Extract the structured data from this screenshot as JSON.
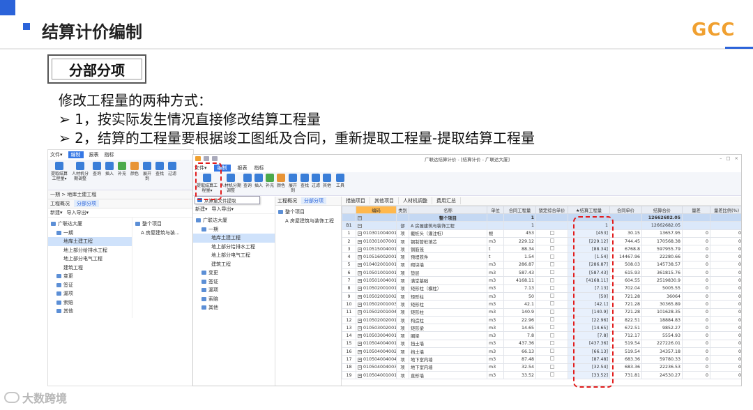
{
  "slide": {
    "title": "结算计价编制",
    "logo": "GCC",
    "section": "分部分项",
    "lines": [
      "修改工程量的两种方式：",
      "➢ 1，按实际发生情况直接修改结算工程量",
      "➢ 2，结算的工程量要根据竣工图纸及合同，重新提取工程量-提取结算工程量"
    ],
    "watermark": "大数跨境"
  },
  "left_app": {
    "menu": [
      "文件▾",
      "编制",
      "报表",
      "指标"
    ],
    "ribbon": [
      "提取结算工程量▾",
      "人材机分期调整",
      "查询",
      "插入",
      "补充",
      "颜色",
      "展开到",
      "查找",
      "过滤"
    ],
    "nav": [
      "一期 > 地库土建工程"
    ],
    "panel_tabs": [
      "工程概况",
      "分部分项"
    ],
    "tree_toolbar": [
      "新建▾",
      "导入导出▾"
    ],
    "tree": [
      {
        "label": "广联达大厦",
        "level": 0
      },
      {
        "label": "一期",
        "level": 1
      },
      {
        "label": "地库土建工程",
        "level": 2,
        "selected": true
      },
      {
        "label": "地上部分给排水工程",
        "level": 2
      },
      {
        "label": "地上部分电气工程",
        "level": 2
      },
      {
        "label": "建筑工程",
        "level": 2
      },
      {
        "label": "变更",
        "level": 1
      },
      {
        "label": "签证",
        "level": 1
      },
      {
        "label": "漏项",
        "level": 1
      },
      {
        "label": "索赔",
        "level": 1
      },
      {
        "label": "其他",
        "level": 1
      }
    ],
    "subtree": [
      "整个项目",
      "A 房屋建筑与装..."
    ]
  },
  "right_app": {
    "window_title": "广联达结算计价 - [结算计价 - 广联达大厦]",
    "menu": [
      "文件▾",
      "编制",
      "报表",
      "指标"
    ],
    "ribbon": [
      "提取结算工程量▾",
      "人材机分期调整",
      "查询",
      "插入",
      "补充",
      "颜色",
      "展开到",
      "查找",
      "过滤",
      "其他",
      "工具"
    ],
    "dropdown_item": "从算量文件提取",
    "tree_toolbar": [
      "新建▾",
      "导入导出▾"
    ],
    "panel_tabs": [
      "工程概况",
      "分部分项"
    ],
    "grid_tabs": [
      "措施项目",
      "其他项目",
      "人材机调整",
      "费用汇总"
    ],
    "subtree": [
      "整个项目",
      "A 房屋建筑与装饰工程"
    ],
    "columns": [
      "",
      "编码",
      "类别",
      "名称",
      "单位",
      "合同工程量",
      "锁定综合单价",
      "★结算工程量",
      "合同单价",
      "结算合价",
      "量差",
      "量差比例(%)"
    ],
    "root_row": {
      "name": "整个项目",
      "qty": "1",
      "settle": "",
      "total": "12662682.05"
    },
    "part_row": {
      "idx": "B1",
      "type": "部",
      "name": "A 房屋建筑与装饰工程",
      "qty": "1",
      "settle": "1",
      "total": "12662682.05"
    },
    "rows": [
      {
        "idx": "1",
        "code": "010301004001",
        "type": "项",
        "name": "截桩头（灌注桩）",
        "unit": "根",
        "qty": "453",
        "settle": "[453]",
        "price": "30.15",
        "total": "13657.95",
        "diff": "0",
        "ratio": "0"
      },
      {
        "idx": "2",
        "code": "010301007001",
        "type": "项",
        "name": "钢制管桩填芯",
        "unit": "m3",
        "qty": "229.12",
        "settle": "[229.12]",
        "price": "744.45",
        "total": "170568.38",
        "diff": "0",
        "ratio": "0"
      },
      {
        "idx": "3",
        "code": "010515004001",
        "type": "项",
        "name": "钢筋笼",
        "unit": "t",
        "qty": "88.34",
        "settle": "[88.34]",
        "price": "6768.8",
        "total": "597955.79",
        "diff": "0",
        "ratio": "0"
      },
      {
        "idx": "4",
        "code": "010516002001",
        "type": "项",
        "name": "预埋铁件",
        "unit": "t",
        "qty": "1.54",
        "settle": "[1.54]",
        "price": "14467.96",
        "total": "22280.66",
        "diff": "0",
        "ratio": "0"
      },
      {
        "idx": "5",
        "code": "010402001001",
        "type": "项",
        "name": "砌块墙",
        "unit": "m3",
        "qty": "286.87",
        "settle": "[286.87]",
        "price": "508.03",
        "total": "145738.57",
        "diff": "0",
        "ratio": "0"
      },
      {
        "idx": "6",
        "code": "010501001001",
        "type": "项",
        "name": "垫层",
        "unit": "m3",
        "qty": "587.43",
        "settle": "[587.43]",
        "price": "615.93",
        "total": "361815.76",
        "diff": "0",
        "ratio": "0"
      },
      {
        "idx": "7",
        "code": "010501004001",
        "type": "项",
        "name": "满堂基础",
        "unit": "m3",
        "qty": "4168.11",
        "settle": "[4168.11]",
        "price": "604.55",
        "total": "2519830.9",
        "diff": "0",
        "ratio": "0"
      },
      {
        "idx": "8",
        "code": "010502001001",
        "type": "项",
        "name": "矩形柱（模柱）",
        "unit": "m3",
        "qty": "7.13",
        "settle": "[7.13]",
        "price": "702.04",
        "total": "5005.55",
        "diff": "0",
        "ratio": "0"
      },
      {
        "idx": "9",
        "code": "010502001002",
        "type": "项",
        "name": "矩形柱",
        "unit": "m3",
        "qty": "50",
        "settle": "[50]",
        "price": "721.28",
        "total": "36064",
        "diff": "0",
        "ratio": "0"
      },
      {
        "idx": "10",
        "code": "010502001003",
        "type": "项",
        "name": "矩形柱",
        "unit": "m3",
        "qty": "42.1",
        "settle": "[42.1]",
        "price": "721.28",
        "total": "30365.89",
        "diff": "0",
        "ratio": "0"
      },
      {
        "idx": "11",
        "code": "010502001004",
        "type": "项",
        "name": "矩形柱",
        "unit": "m3",
        "qty": "140.9",
        "settle": "[140.9]",
        "price": "721.28",
        "total": "101628.35",
        "diff": "0",
        "ratio": "0"
      },
      {
        "idx": "12",
        "code": "010502002001",
        "type": "项",
        "name": "构造柱",
        "unit": "m3",
        "qty": "22.96",
        "settle": "[22.96]",
        "price": "822.51",
        "total": "18884.83",
        "diff": "0",
        "ratio": "0"
      },
      {
        "idx": "13",
        "code": "010503002001",
        "type": "项",
        "name": "矩形梁",
        "unit": "m3",
        "qty": "14.65",
        "settle": "[14.65]",
        "price": "672.51",
        "total": "9852.27",
        "diff": "0",
        "ratio": "0"
      },
      {
        "idx": "14",
        "code": "010503004001",
        "type": "项",
        "name": "圈梁",
        "unit": "m3",
        "qty": "7.8",
        "settle": "[7.8]",
        "price": "712.17",
        "total": "5554.93",
        "diff": "0",
        "ratio": "0"
      },
      {
        "idx": "15",
        "code": "010504004001",
        "type": "项",
        "name": "挡土墙",
        "unit": "m3",
        "qty": "437.36",
        "settle": "[437.36]",
        "price": "519.54",
        "total": "227226.01",
        "diff": "0",
        "ratio": "0"
      },
      {
        "idx": "16",
        "code": "010504004002",
        "type": "项",
        "name": "挡土墙",
        "unit": "m3",
        "qty": "66.13",
        "settle": "[66.13]",
        "price": "519.54",
        "total": "34357.18",
        "diff": "0",
        "ratio": "0"
      },
      {
        "idx": "17",
        "code": "010504004004",
        "type": "项",
        "name": "地下室内墙",
        "unit": "m3",
        "qty": "87.48",
        "settle": "[87.48]",
        "price": "683.36",
        "total": "59780.33",
        "diff": "0",
        "ratio": "0"
      },
      {
        "idx": "18",
        "code": "010504004003",
        "type": "项",
        "name": "地下室内墙",
        "unit": "m3",
        "qty": "32.54",
        "settle": "[32.54]",
        "price": "683.36",
        "total": "22236.53",
        "diff": "0",
        "ratio": "0"
      },
      {
        "idx": "19",
        "code": "010504001001",
        "type": "项",
        "name": "直形墙",
        "unit": "m3",
        "qty": "33.52",
        "settle": "[33.52]",
        "price": "731.81",
        "total": "24530.27",
        "diff": "0",
        "ratio": "0"
      }
    ]
  }
}
